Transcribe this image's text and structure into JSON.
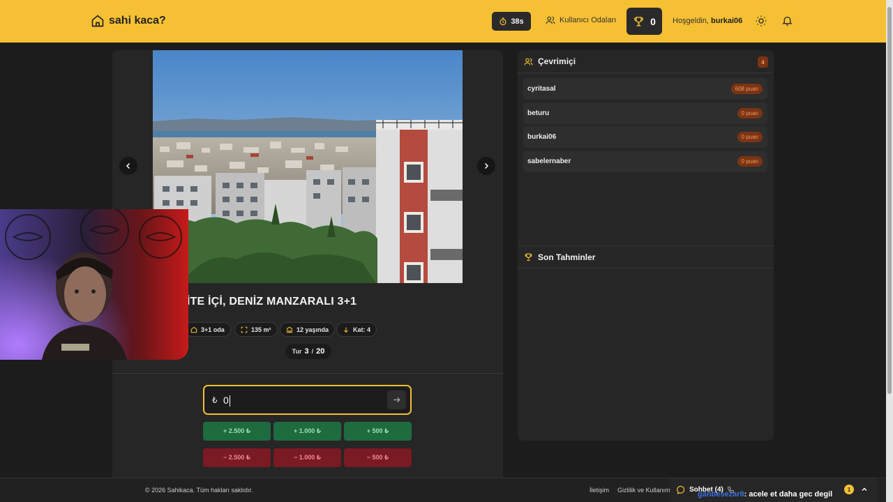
{
  "header": {
    "brand": "sahi kaca?",
    "timer": "38s",
    "rooms_label": "Kullanıcı Odaları",
    "score": "0",
    "welcome_prefix": "Hoşgeldin,",
    "username": "burkai06"
  },
  "listing": {
    "title": "SİTE İÇİ, DENİZ MANZARALI 3+1",
    "features": [
      {
        "icon": "home-icon",
        "label": "3+1 oda"
      },
      {
        "icon": "expand-icon",
        "label": "135 m²"
      },
      {
        "icon": "building-icon",
        "label": "12 yaşında"
      },
      {
        "icon": "arrow-down-icon",
        "label": "Kat: 4"
      }
    ],
    "round_label": "Tur",
    "round_current": "3",
    "round_sep": "/",
    "round_total": "20"
  },
  "guess": {
    "currency": "₺",
    "value": "0",
    "plus_buttons": [
      "+ 2.500 ₺",
      "+ 1.000 ₺",
      "+ 500 ₺"
    ],
    "minus_buttons": [
      "− 2.500 ₺",
      "− 1.000 ₺",
      "− 500 ₺"
    ]
  },
  "online": {
    "title": "Çevrimiçi",
    "count": "4",
    "players": [
      {
        "name": "cyritasal",
        "points": "608 puan"
      },
      {
        "name": "beturu",
        "points": "0 puan"
      },
      {
        "name": "burkai06",
        "points": "0 puan"
      },
      {
        "name": "sabelernaber",
        "points": "0 puan"
      }
    ]
  },
  "recent": {
    "title": "Son Tahminler"
  },
  "footer": {
    "copyright": "© 2026 Sahikaca. Tüm hakları saklıdır.",
    "links": [
      "İletişim",
      "Gizlilik ve Kullanım"
    ]
  },
  "chat": {
    "label": "Sohbet (4)",
    "last_user": "ganbesezar8",
    "last_message": ": acele et daha gec degil",
    "unread": "1"
  },
  "colors": {
    "accent": "#f5c033",
    "header_bg": "#f5c033",
    "panel_bg": "#262626",
    "plus_bg": "#1d6b3f",
    "minus_bg": "#7a1a23",
    "points_badge": "#7b3414"
  }
}
